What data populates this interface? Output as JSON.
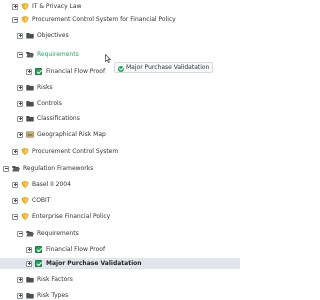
{
  "tree": [
    {
      "label": "IT & Privacy Law",
      "icon": "shield-icon",
      "toggle": "plus",
      "level": 1
    },
    {
      "label": "Procurement Control System for Financial Policy",
      "icon": "shield-icon",
      "toggle": "minus",
      "level": 1
    },
    {
      "label": "Objectives",
      "icon": "folder-icon",
      "toggle": "plus",
      "level": 2
    },
    {
      "label": "Requirements",
      "icon": "folder-open-icon",
      "toggle": "minus",
      "level": 2,
      "style": "green"
    },
    {
      "label": "Financial Flow Proof",
      "icon": "check-icon",
      "toggle": "plus",
      "level": 3
    },
    {
      "label": "Risks",
      "icon": "folder-icon",
      "toggle": "plus",
      "level": 2
    },
    {
      "label": "Controls",
      "icon": "folder-icon",
      "toggle": "plus",
      "level": 2
    },
    {
      "label": "Classifications",
      "icon": "folder-icon",
      "toggle": "plus",
      "level": 2
    },
    {
      "label": "Geographical Risk Map",
      "icon": "map-icon",
      "toggle": "plus",
      "level": 2
    },
    {
      "label": "Procurement Control System",
      "icon": "shield-icon",
      "toggle": "plus",
      "level": 1
    },
    {
      "label": "Regulation Frameworks",
      "icon": "folder-open-icon",
      "toggle": "minus",
      "level": 0
    },
    {
      "label": "Basel II 2004",
      "icon": "shield-icon",
      "toggle": "plus",
      "level": 1
    },
    {
      "label": "COBIT",
      "icon": "shield-icon",
      "toggle": "plus",
      "level": 1
    },
    {
      "label": "Enterprise Financial Policy",
      "icon": "shield-icon",
      "toggle": "minus",
      "level": 1
    },
    {
      "label": "Requirements",
      "icon": "folder-open-icon",
      "toggle": "minus",
      "level": 2
    },
    {
      "label": "Financial Flow Proof",
      "icon": "check-icon",
      "toggle": "plus",
      "level": 3
    },
    {
      "label": "Major Purchase Validatation",
      "icon": "check-icon",
      "toggle": "plus",
      "level": 3,
      "style": "bold",
      "selected": true
    },
    {
      "label": "Risk Factors",
      "icon": "folder-icon",
      "toggle": "plus",
      "level": 2
    },
    {
      "label": "Risk Types",
      "icon": "folder-icon",
      "toggle": "plus",
      "level": 2
    }
  ],
  "drag_tooltip": {
    "text": "Major Purchase Validatation",
    "icon": "check-circle-icon"
  },
  "colors": {
    "accent_green": "#23a55a",
    "selected_row": "#e2e6ec",
    "shield_yellow": "#f0b429",
    "folder_dark": "#4a4d52"
  }
}
